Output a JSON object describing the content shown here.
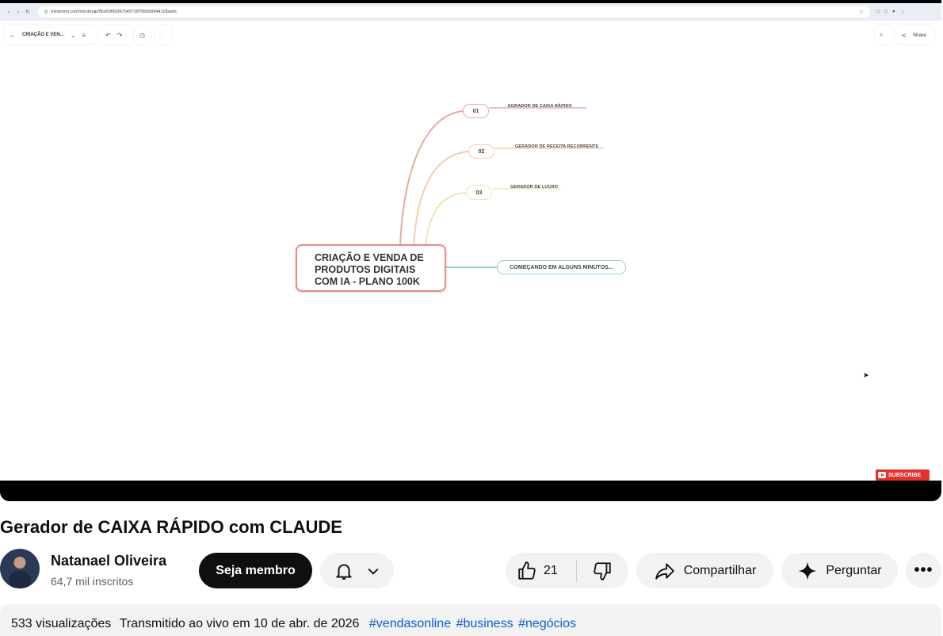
{
  "browser": {
    "url": "mindomo.com/mindmap/56a50f6036704572876b5b9944118aa6c"
  },
  "mindmap_app": {
    "map_title_short": "CRIAÇÃO E VEN...",
    "share_label": "Share",
    "central_topic": [
      "CRIAÇÃO E VENDA DE",
      "PRODUTOS DIGITAIS",
      "COM IA - PLANO 100K"
    ],
    "branches": [
      {
        "number": "01",
        "label": "EGRADOR DE CAIXA RÁPIDO",
        "color": "#eaa9a3"
      },
      {
        "number": "02",
        "label": "GERADOR DE RECEITA RECORRENTE",
        "color": "#f2cfad"
      },
      {
        "number": "03",
        "label": "GERADOR DE LUCRO",
        "color": "#f3e4b4"
      },
      {
        "number": "",
        "label": "COMEÇANDO EM ALGUNS MINUTOS...",
        "color": "#9fd3c7"
      }
    ],
    "subscribe_label": "SUBSCRIBE"
  },
  "video": {
    "title": "Gerador de CAIXA RÁPIDO com CLAUDE",
    "channel_name": "Natanael Oliveira",
    "subscribers": "64,7 mil inscritos",
    "member_button": "Seja membro",
    "like_count": "21",
    "share_button": "Compartilhar",
    "ask_button": "Perguntar",
    "views": "533 visualizações",
    "streamed": "Transmitido ao vivo em 10 de abr. de 2026",
    "hashtags": [
      "#vendasonline",
      "#business",
      "#negócios"
    ]
  },
  "icons": {
    "like": "thumbs-up-icon",
    "dislike": "thumbs-down-icon",
    "share": "share-arrow-icon",
    "ask": "sparkle-icon",
    "bell": "bell-icon",
    "more": "more-horizontal-icon"
  },
  "colors": {
    "central_border": "#e88b86",
    "hashtag": "#065fd4",
    "subscribe_bg": "#e5322d"
  }
}
